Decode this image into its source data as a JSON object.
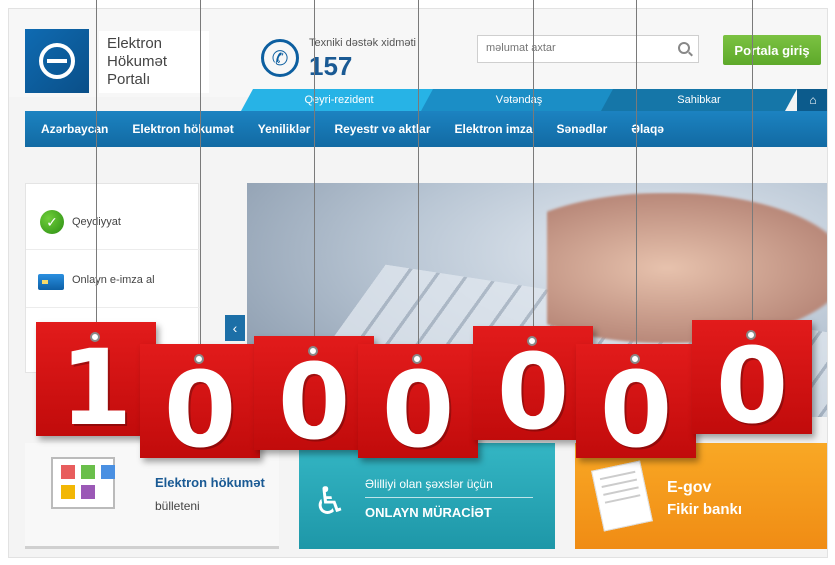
{
  "header": {
    "logo_lines": [
      "Elektron",
      "Hökumət",
      "Portalı"
    ],
    "support_label": "Texniki dəstək xidməti",
    "support_number": "157",
    "search_placeholder": "məlumat axtar",
    "portal_button": "Portala giriş"
  },
  "audience_tabs": [
    "Qeyri-rezident",
    "Vətəndaş",
    "Sahibkar"
  ],
  "nav": [
    "Azərbaycan",
    "Elektron hökumət",
    "Yeniliklər",
    "Reyestr və aktlar",
    "Elektron imza",
    "Sənədlər",
    "Əlaqə"
  ],
  "sidebar": {
    "items": [
      {
        "label": "Qeydiyyat",
        "icon": "check-icon"
      },
      {
        "label": "Onlayn e-imza al",
        "icon": "card-icon"
      }
    ]
  },
  "cards": {
    "bulletin": {
      "title": "Elektron hökumət",
      "subtitle": "bülleteni"
    },
    "disability": {
      "title": "Əlilliyi olan şəxslər üçün",
      "subtitle": "ONLAYN MÜRACİƏT"
    },
    "egov": {
      "title": "E-gov",
      "subtitle": "Fikir bankı"
    }
  },
  "counter": {
    "digits": [
      "1",
      "0",
      "0",
      "0",
      "0",
      "0",
      "0"
    ],
    "color": "#d31212"
  }
}
